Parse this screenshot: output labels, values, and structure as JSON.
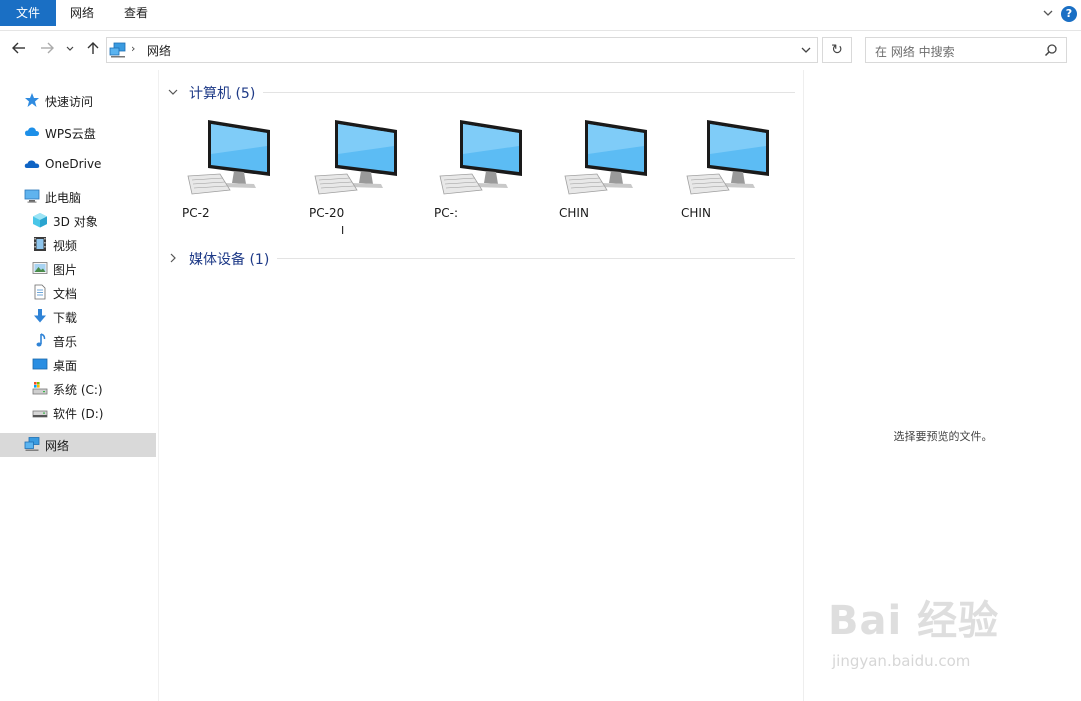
{
  "ribbon": {
    "tabs": [
      "文件",
      "网络",
      "查看"
    ],
    "accent": "#1a6fc4"
  },
  "navbar": {
    "address_path": "网络",
    "search_placeholder": "在 网络 中搜索"
  },
  "sidebar": {
    "items": [
      {
        "label": "快速访问",
        "icon": "star-icon"
      },
      {
        "label": "WPS云盘",
        "icon": "cloud-icon"
      },
      {
        "label": "OneDrive",
        "icon": "onedrive-cloud-icon"
      },
      {
        "label": "此电脑",
        "icon": "this-pc-icon"
      },
      {
        "label": "3D 对象",
        "icon": "3d-objects-icon"
      },
      {
        "label": "视频",
        "icon": "videos-icon"
      },
      {
        "label": "图片",
        "icon": "pictures-icon"
      },
      {
        "label": "文档",
        "icon": "documents-icon"
      },
      {
        "label": "下载",
        "icon": "downloads-icon"
      },
      {
        "label": "音乐",
        "icon": "music-icon"
      },
      {
        "label": "桌面",
        "icon": "desktop-icon"
      },
      {
        "label": "系统 (C:)",
        "icon": "system-drive-icon"
      },
      {
        "label": "软件 (D:)",
        "icon": "drive-icon"
      },
      {
        "label": "网络",
        "icon": "network-icon"
      }
    ],
    "selected": "网络"
  },
  "main": {
    "groups": [
      {
        "title": "计算机 (5)",
        "expanded": true
      },
      {
        "title": "媒体设备 (1)",
        "expanded": false
      }
    ],
    "computers": [
      {
        "name": "PC-2",
        "name_line2": ""
      },
      {
        "name": "PC-20",
        "name_line2": "I"
      },
      {
        "name": "PC-:",
        "name_line2": ""
      },
      {
        "name": "CHIN",
        "name_line2": ""
      },
      {
        "name": "CHIN",
        "name_line2": ""
      }
    ]
  },
  "preview": {
    "message": "选择要预览的文件。"
  },
  "watermark": {
    "logo_text": "Bai 经验",
    "url": "jingyan.baidu.com"
  }
}
